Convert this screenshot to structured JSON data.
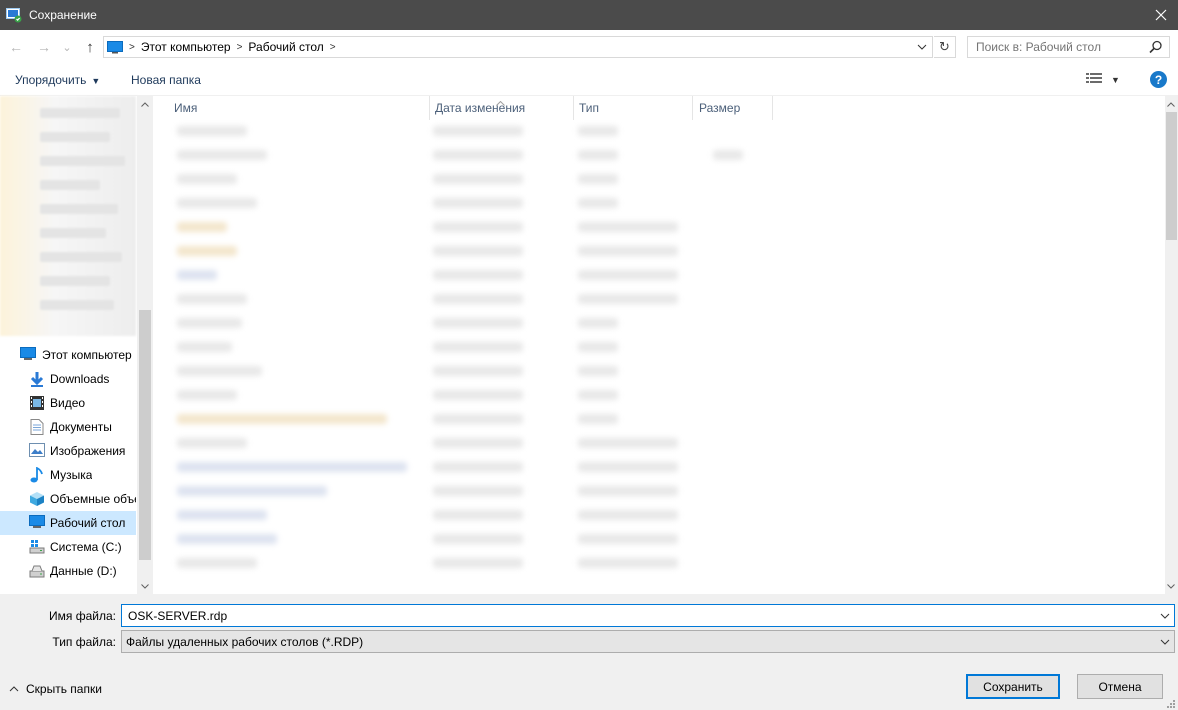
{
  "window": {
    "title": "Сохранение",
    "close_glyph": "✕"
  },
  "navigation": {
    "back_glyph": "←",
    "forward_glyph": "→",
    "recent_glyph": "⌄",
    "up_glyph": "↑",
    "breadcrumb": [
      "Этот компьютер",
      "Рабочий стол"
    ],
    "refresh_glyph": "↻",
    "search_placeholder": "Поиск в: Рабочий стол"
  },
  "toolbar": {
    "organize_label": "Упорядочить",
    "new_folder_label": "Новая папка",
    "help_label": "?"
  },
  "sidebar": {
    "items": [
      {
        "label": "Этот компьютер",
        "icon": "computer-icon",
        "selected": false
      },
      {
        "label": "Downloads",
        "icon": "download-icon",
        "selected": false
      },
      {
        "label": "Видео",
        "icon": "video-icon",
        "selected": false
      },
      {
        "label": "Документы",
        "icon": "document-icon",
        "selected": false
      },
      {
        "label": "Изображения",
        "icon": "image-icon",
        "selected": false
      },
      {
        "label": "Музыка",
        "icon": "music-icon",
        "selected": false
      },
      {
        "label": "Объемные объекты",
        "icon": "cube-icon",
        "selected": false
      },
      {
        "label": "Рабочий стол",
        "icon": "desktop-icon",
        "selected": true
      },
      {
        "label": "Система (C:)",
        "icon": "drive-c-icon",
        "selected": false
      },
      {
        "label": "Данные (D:)",
        "icon": "drive-d-icon",
        "selected": false
      }
    ]
  },
  "file_list": {
    "columns": [
      "Имя",
      "Дата изменения",
      "Тип",
      "Размер"
    ],
    "content": "blurred"
  },
  "form": {
    "filename_label": "Имя файла:",
    "filename_value": "OSK-SERVER.rdp",
    "filetype_label": "Тип файла:",
    "filetype_value": "Файлы удаленных рабочих столов (*.RDP)"
  },
  "footer": {
    "hide_folders_label": "Скрыть папки",
    "save_label": "Сохранить",
    "cancel_label": "Отмена"
  },
  "colors": {
    "titlebar": "#4b4b4b",
    "accent": "#0078d7",
    "selection": "#cce8ff"
  }
}
